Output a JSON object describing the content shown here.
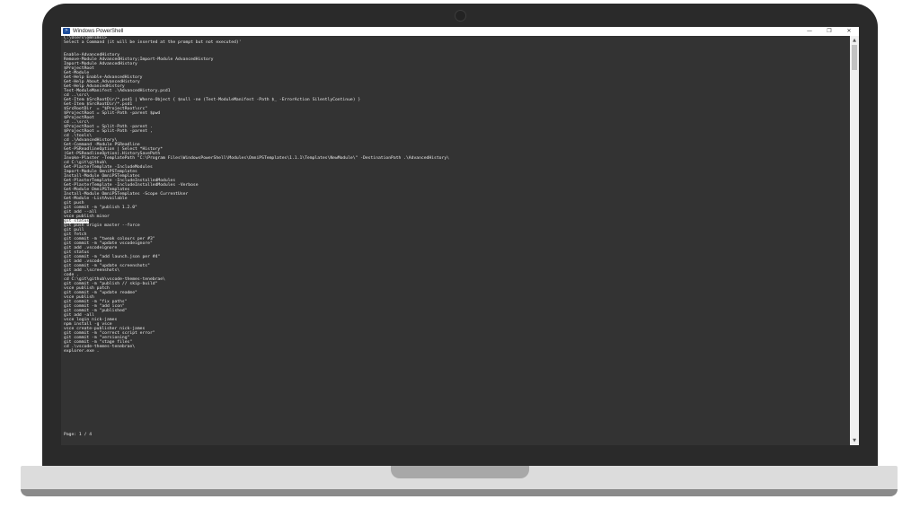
{
  "window": {
    "title": "Windows PowerShell",
    "icon": "powershell-icon",
    "controls": {
      "minimize": "—",
      "maximize": "❐",
      "close": "✕"
    }
  },
  "console": {
    "path_line": "C:\\Users\\omnimsi>",
    "prompt_line": "Select a Command (it will be inserted at the prompt but not executed)'",
    "selected_index": 37,
    "commands": [
      "Enable-AdvancedHistory",
      "Remove-Module AdvancedHistory;Import-Module AdvancedHistory",
      "Import-Module AdvancedHistory",
      "$ProjectRoot",
      "Get-Module",
      "Get-Help Enable-AdvancedHistory",
      "Get-Help About_AdvancedHistory",
      "Get-Help AdvancedHistory",
      "Test-ModuleManifest .\\AdvancedHistory.psd1",
      "cd ..\\src\\",
      "Get-Item $SrcRootDir/*.psd1 | Where-Object { $null -ne (Test-ModuleManifest -Path $_ -ErrorAction SilentlyContinue) }",
      "Get-Item $SrcRootDir/*.psd1",
      "$SrcRootDir  = \"$ProjectRoot\\src\"",
      "$ProjectRoot = Split-Path -parent $pwd",
      "$ProjectRoot",
      "cd ..\\src\\",
      "$ProjectRoot = Split-Path -parent .",
      "$ProjectRoot = Split-Path -parent ,",
      "cd .\\tools\\",
      "cd .\\AdvancedHistory\\",
      "Get-Command -Module PSReadline",
      "Get-PSReadlineOption | Select *History*",
      "(Get-PSReadlineOption).HistorySavePath",
      "Invoke-Plaster -TemplatePath \"C:\\Program Files\\WindowsPowerShell\\Modules\\OmniPSTemplates\\1.1.1\\Templates\\NewModule\\\" -DestinationPath .\\AdvancedHistory\\",
      "cd C:\\git\\github\\",
      "Get-PlasterTemplate -IncludeModules",
      "Import-Module OmniPSTemplates",
      "Install-Module OmniPSTemplates",
      "Get-PlasterTemplate -IncludeInstalledModules",
      "Get-PlasterTemplate -IncludeInstalledModules -Verbose",
      "Get-Module OmniPSTemplates",
      "Install-Module OmniPSTemplates -Scope CurrentUser",
      "Get-Module -ListAvailable",
      "git push",
      "git commit -m \"publish 1.2.0\"",
      "git add --all",
      "vsce publish minor",
      "git status",
      "git push origin master --force",
      "git pull",
      "git fetch",
      "git commit -m \"tweak colours per #3\"",
      "git commit -m \"update vscodeignore\"",
      "git add .vscodeignore",
      "git status",
      "git commit -m \"add launch.json per #4\"",
      "git add .vscode",
      "git commit -m \"update screenshots\"",
      "git add .\\screenshots\\",
      "code .",
      "cd C:\\git\\github\\vscode-themes-tenebrae\\",
      "git commit -m \"publish // skip-build\"",
      "vsce publish patch",
      "git commit -m \"update readme\"",
      "vsce publish",
      "git commit -m \"fix paths\"",
      "git commit -m \"add icon\"",
      "git commit -m \"published\"",
      "git add -all",
      "vsce login nick-james",
      "npm install -g vsce",
      "vsce create-publisher nick-james",
      "git commit -m \"correct script error\"",
      "git commit -m \"versioning\"",
      "git commit -m \"stage files\"",
      "cd .\\vscode-themes-tenebrae\\",
      "explorer.exe ."
    ],
    "page_label": "Page: 1 / 4"
  },
  "scrollbar": {
    "up_arrow": "▲",
    "down_arrow": "▼"
  },
  "colors": {
    "console_bg": "#333333",
    "console_text": "#e8e8e8",
    "selection_bg": "#f2f2f2",
    "bezel": "#2a2a2a",
    "titlebar": "#ffffff"
  }
}
